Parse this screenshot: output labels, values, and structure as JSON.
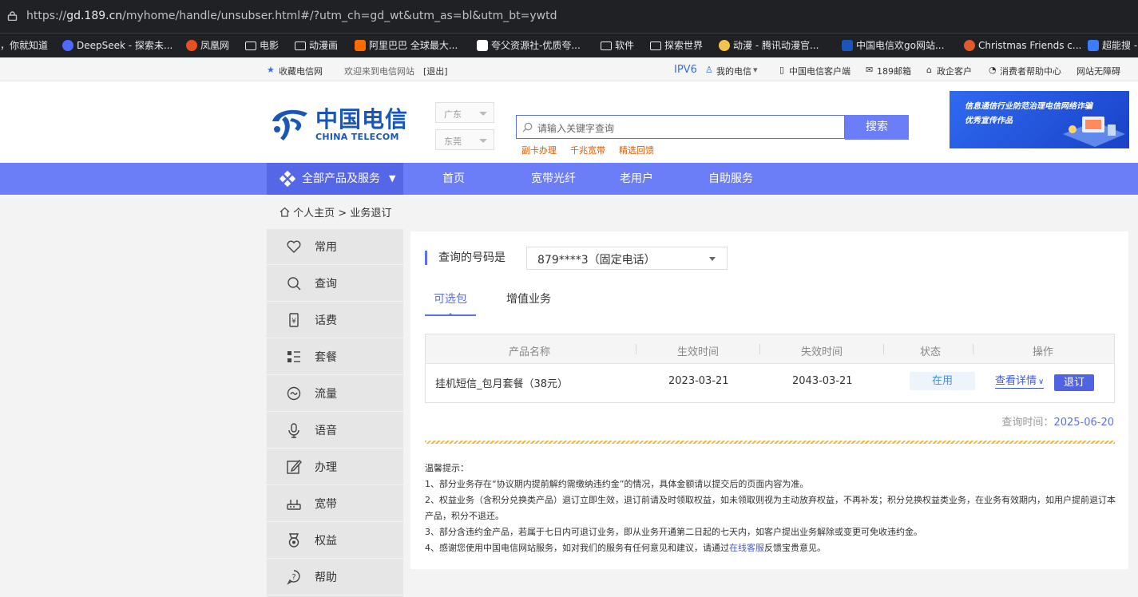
{
  "browser": {
    "url_prefix": "https://",
    "url_host": "gd.189.cn",
    "url_path": "/myhome/handle/unsubser.html#/?utm_ch=gd_wt&utm_as=bl&utm_bt=ywtd",
    "bookmarks": [
      {
        "label": "，你就知道",
        "icon": "none"
      },
      {
        "label": "DeepSeek - 探索未...",
        "icon": "deepseek-icon",
        "color": "#4d6bfe"
      },
      {
        "label": "凤凰网",
        "icon": "ifeng-icon",
        "color": "#e8501d"
      },
      {
        "label": "电影",
        "icon": "folder-icon"
      },
      {
        "label": "动漫画",
        "icon": "folder-icon"
      },
      {
        "label": "阿里巴巴 全球最大...",
        "icon": "alibaba-icon",
        "color": "#ff6a00"
      },
      {
        "label": "夸父资源社-优质夸...",
        "icon": "kuafu-icon",
        "color": "#ffffff"
      },
      {
        "label": "软件",
        "icon": "folder-icon"
      },
      {
        "label": "探索世界",
        "icon": "folder-icon"
      },
      {
        "label": "动漫 - 腾讯动漫官...",
        "icon": "tencent-comic-icon",
        "color": "#f2c14e"
      },
      {
        "label": "中国电信欢go网站...",
        "icon": "telecom-icon",
        "color": "#1a56b8"
      },
      {
        "label": "Christmas Friends c...",
        "icon": "christmas-icon",
        "color": "#e05a2a"
      },
      {
        "label": "超能搜 -",
        "icon": "search-app-icon",
        "color": "#3b7bff"
      }
    ]
  },
  "topbar": {
    "favorite": "收藏电信网",
    "welcome": "欢迎来到电信网站",
    "logout": "[退出]",
    "ipv6": "IPV6",
    "my_telecom": "我的电信",
    "client": "中国电信客户端",
    "mail": "189邮箱",
    "gov": "政企客户",
    "consumer": "消费者帮助中心",
    "accessible": "网站无障碍"
  },
  "header": {
    "logo_cn": "中国电信",
    "logo_en": "CHINA TELECOM",
    "province": "广东",
    "city": "东莞",
    "search_placeholder": "请输入关键字查询",
    "search_button": "搜索",
    "hot_links": [
      "副卡办理",
      "千兆宽带",
      "精选回馈"
    ],
    "banner_line1": "信息通信行业防范治理电信网络诈骗",
    "banner_line2": "优秀宣传作品"
  },
  "nav": {
    "all": "全部产品及服务",
    "items": [
      "首页",
      "宽带光纤",
      "老用户",
      "自助服务"
    ]
  },
  "breadcrumb": {
    "home": "个人主页",
    "sep": ">",
    "current": "业务退订"
  },
  "sidebar": {
    "items": [
      {
        "label": "常用",
        "icon": "heart-icon"
      },
      {
        "label": "查询",
        "icon": "search-icon"
      },
      {
        "label": "话费",
        "icon": "bill-icon"
      },
      {
        "label": "套餐",
        "icon": "package-icon"
      },
      {
        "label": "流量",
        "icon": "data-flow-icon"
      },
      {
        "label": "语音",
        "icon": "microphone-icon"
      },
      {
        "label": "办理",
        "icon": "edit-icon"
      },
      {
        "label": "宽带",
        "icon": "router-icon"
      },
      {
        "label": "权益",
        "icon": "medal-icon"
      },
      {
        "label": "帮助",
        "icon": "help-icon"
      }
    ]
  },
  "main": {
    "query_label": "查询的号码是",
    "number_value": "879****3（固定电话）",
    "tabs": [
      "可选包",
      "增值业务"
    ],
    "table": {
      "headers": [
        "产品名称",
        "生效时间",
        "失效时间",
        "状态",
        "操作"
      ],
      "rows": [
        {
          "name": "挂机短信_包月套餐（38元）",
          "start": "2023-03-21",
          "end": "2043-03-21",
          "status": "在用",
          "detail": "查看详情",
          "action": "退订"
        }
      ]
    },
    "query_time_label": "查询时间：",
    "query_time": "2025-06-20",
    "tips_title": "温馨提示：",
    "tips": [
      "1、部分业务存在“协议期内提前解约需缴纳违约金”的情况，具体金额请以提交后的页面内容为准。",
      "2、权益业务（含积分兑换类产品）退订立即生效，退订前请及时领取权益，如未领取则视为主动放弃权益，不再补发；积分兑换权益类业务，在业务有效期内，如用户提前退订本产品，积分不退还。",
      "3、部分含违约金产品，若属于七日内可退订业务，即从业务开通第二日起的七天内，如客户提出业务解除或变更可免收违约金。"
    ],
    "tip4_prefix": "4、感谢您使用中国电信网站服务，如对我们的服务有任何意见和建议，请通过",
    "tip4_link": "在线客服",
    "tip4_suffix": "反馈宝贵意见。"
  }
}
